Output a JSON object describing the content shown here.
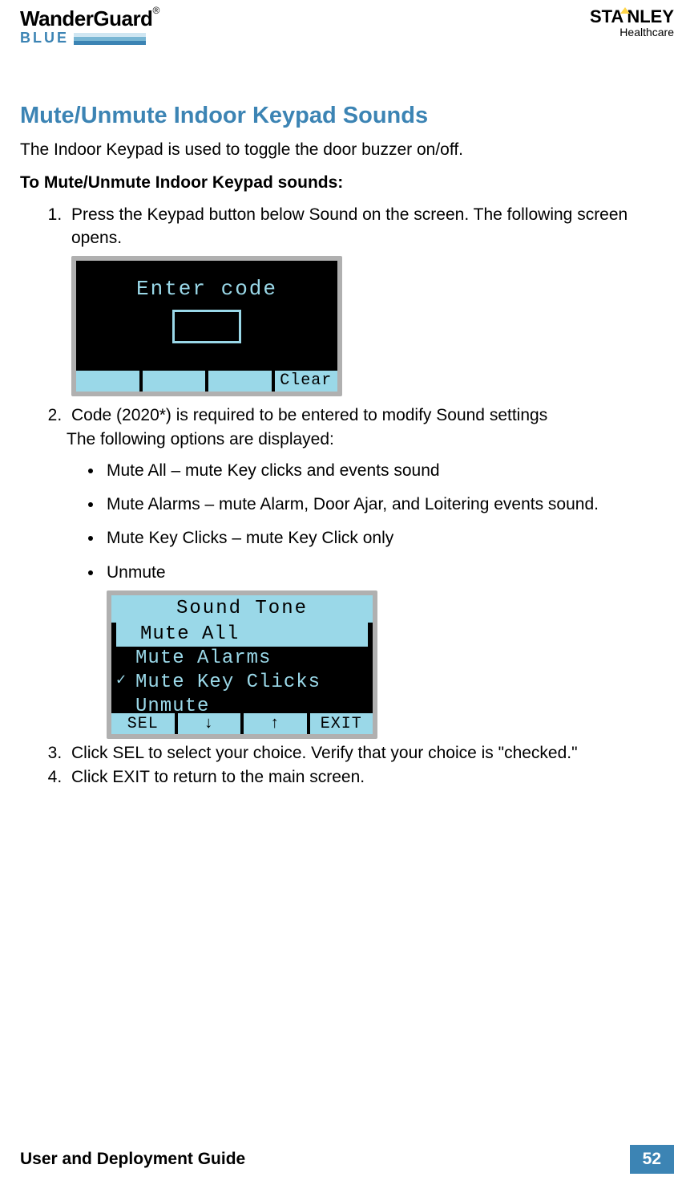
{
  "header": {
    "logo_main": "WanderGuard",
    "logo_reg": "®",
    "logo_sub": "BLUE",
    "brand_main": "STANLEY",
    "brand_sub": "Healthcare"
  },
  "title": "Mute/Unmute Indoor Keypad Sounds",
  "intro": "The Indoor Keypad is used to toggle the door buzzer on/off.",
  "subhead": "To Mute/Unmute Indoor Keypad sounds:",
  "steps": {
    "s1": "Press the Keypad button below Sound on the screen. The following screen opens.",
    "s2a": " Code (2020*) is required to be entered to modify Sound settings",
    "s2b": "The following options are displayed:",
    "s3": "Click SEL to select your choice. Verify that your choice is \"checked.\"",
    "s4": "Click EXIT to return to the main screen."
  },
  "options": {
    "o1": "Mute All – mute Key clicks and events sound",
    "o2": "Mute Alarms – mute Alarm, Door Ajar, and Loitering events sound.",
    "o3": "Mute Key Clicks – mute Key Click only",
    "o4": "Unmute"
  },
  "lcd1": {
    "title": "Enter code",
    "btn1": "",
    "btn2": "",
    "btn3": "",
    "btn4": "Clear"
  },
  "lcd2": {
    "title": "Sound Tone",
    "m1": "Mute All",
    "m2": "Mute Alarms",
    "m3": "Mute Key Clicks",
    "m4": "Unmute",
    "b1": "SEL",
    "b2": "↓",
    "b3": "↑",
    "b4": "EXIT"
  },
  "footer": {
    "title": "User and Deployment Guide",
    "page": "52"
  }
}
